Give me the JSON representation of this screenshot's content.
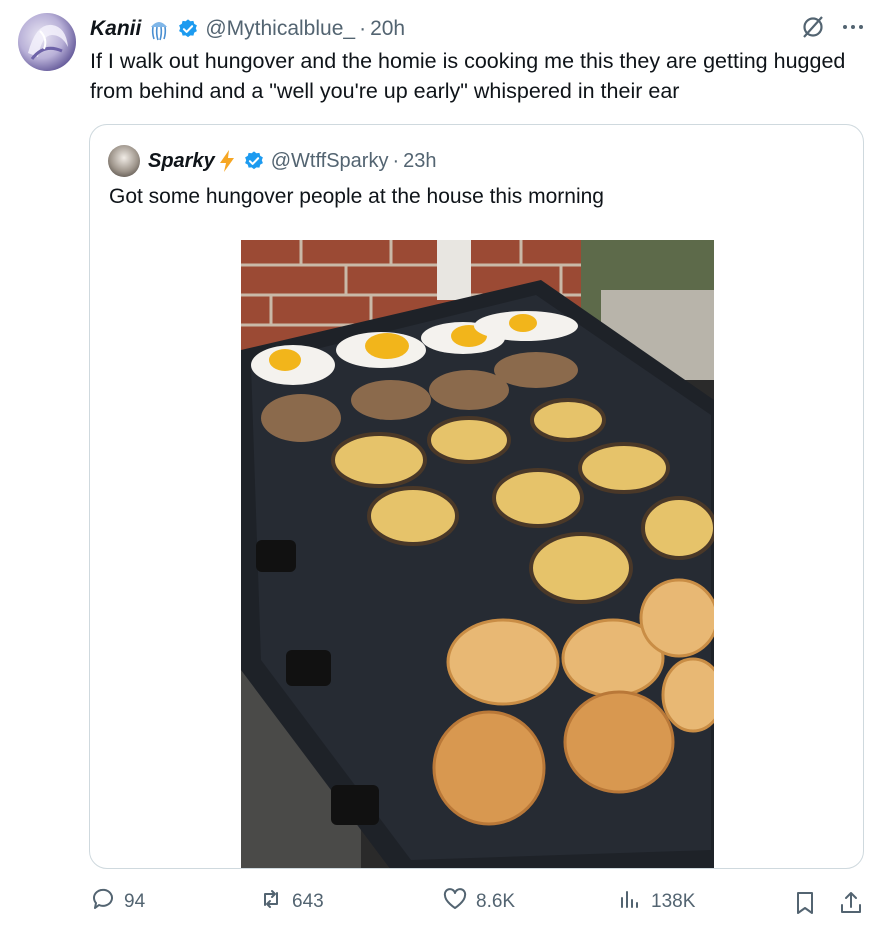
{
  "tweet": {
    "author": {
      "name": "Kanii",
      "handle": "@Mythicalblue_",
      "time": "20h",
      "emoji": "jellyfish-icon"
    },
    "text": "If I walk out hungover and the homie is cooking me this they are getting hugged from behind and a \"well you're up early\" whispered in their ear",
    "separator": "·"
  },
  "quote": {
    "author": {
      "name": "Sparky",
      "handle": "@WtffSparky",
      "time": "23h",
      "emoji": "lightning-icon"
    },
    "text": "Got some hungover people at the house this morning"
  },
  "actions": {
    "replies": "94",
    "reposts": "643",
    "likes": "8.6K",
    "views": "138K"
  },
  "colors": {
    "verified": "#1d9bf0",
    "muted": "#536471",
    "text": "#0f1419",
    "border": "#cfd9de"
  }
}
